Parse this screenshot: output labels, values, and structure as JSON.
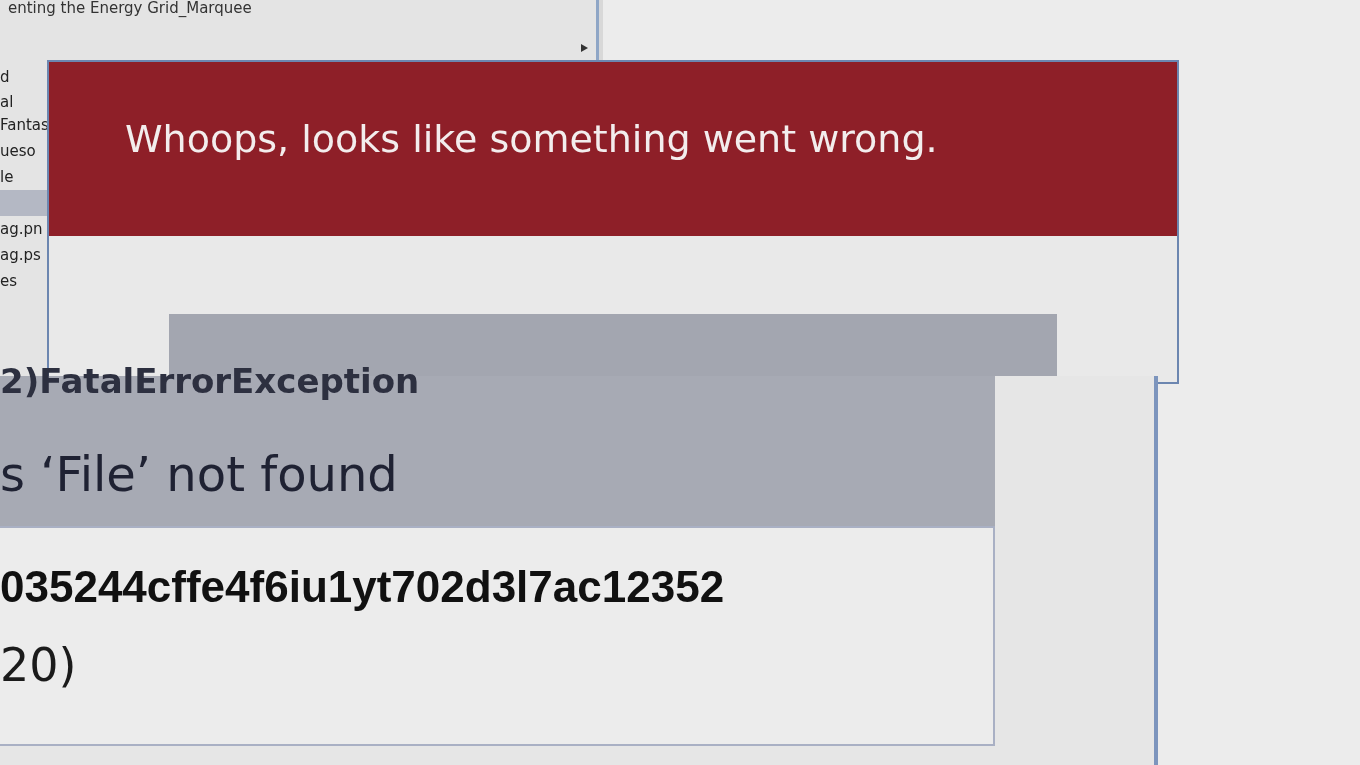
{
  "file_panel": {
    "path": "enting the Energy Grid_Marquee",
    "items": [
      {
        "label": "d",
        "selected": false
      },
      {
        "label": "al",
        "selected": false
      },
      {
        "label": "Fantas",
        "selected": false
      },
      {
        "label": "ueso",
        "selected": false
      },
      {
        "label": "le",
        "selected": false
      },
      {
        "selected": true
      },
      {
        "label": "ag.pn",
        "selected": false
      },
      {
        "label": "ag.ps",
        "selected": false
      },
      {
        "label": "es",
        "selected": false
      }
    ]
  },
  "error_dialog": {
    "title": "Whoops, looks like something went wrong."
  },
  "magnified": {
    "exception": "2)FatalErrorException",
    "message": "s ‘File’ not found",
    "hash": "035244cffe4f6iu1yt702d3l7ac12352",
    "line": "20)"
  }
}
